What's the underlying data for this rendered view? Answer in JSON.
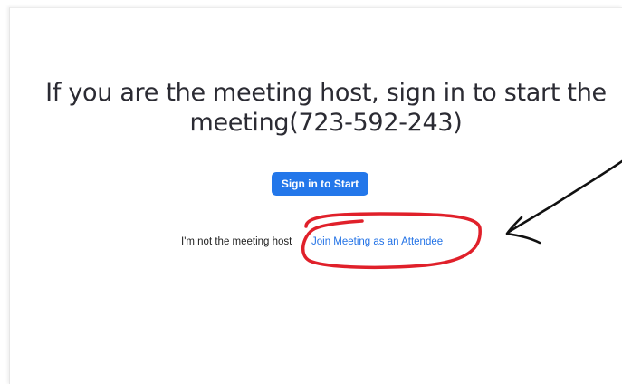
{
  "headline": {
    "line1": "If you are the meeting host, sign in to start the",
    "line2": "meeting(723-592-243)"
  },
  "signin_button": {
    "label": "Sign in to Start"
  },
  "attendee": {
    "prompt": "I'm not the meeting host",
    "link_label": "Join Meeting as an Attendee"
  },
  "colors": {
    "accent": "#2377ea",
    "link": "#2272e6",
    "annotation_red": "#e0202a",
    "annotation_arrow": "#111111"
  },
  "icons": {
    "highlight": "red-circle-highlight-icon",
    "arrow": "hand-drawn-arrow-icon"
  }
}
